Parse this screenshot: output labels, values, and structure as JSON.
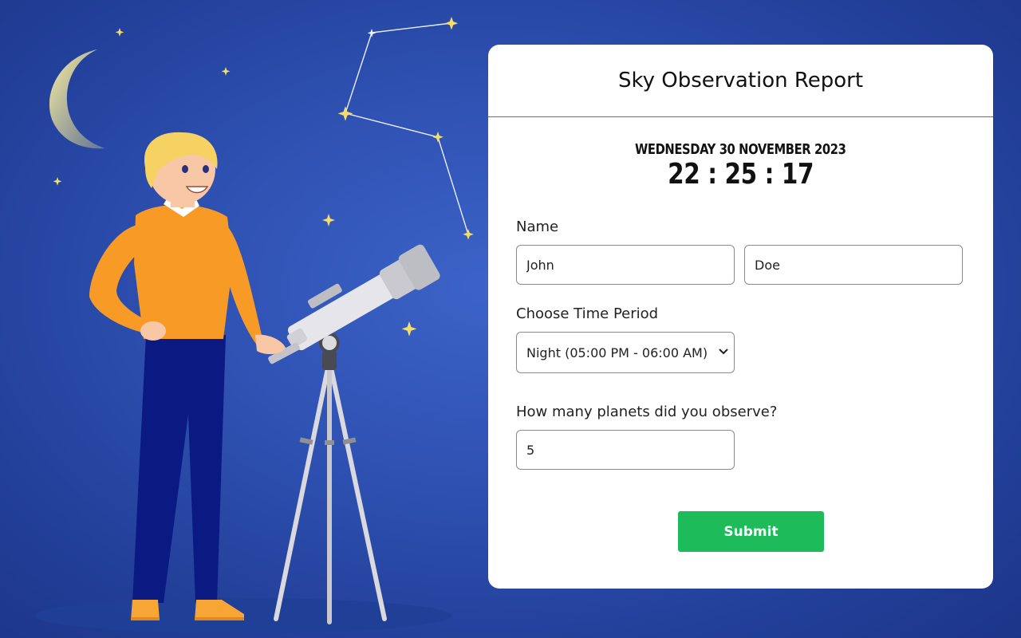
{
  "report": {
    "title": "Sky Observation Report",
    "date": "Wednesday 30 November 2023",
    "time": "22 : 25 : 17"
  },
  "form": {
    "name_label": "Name",
    "first_name": "John",
    "last_name": "Doe",
    "period_label": "Choose Time Period",
    "period_value": "Night (05:00 PM - 06:00 AM)",
    "planets_label": "How many planets did you observe?",
    "planets_value": "5",
    "submit_label": "Submit"
  },
  "colors": {
    "background": "#2f52b3",
    "card": "#ffffff",
    "submit": "#1dbb5a",
    "sweater": "#f79a26",
    "pants": "#0a1a82",
    "star": "#f5dd6b"
  },
  "icons": {
    "select": "chevron-down-icon"
  }
}
